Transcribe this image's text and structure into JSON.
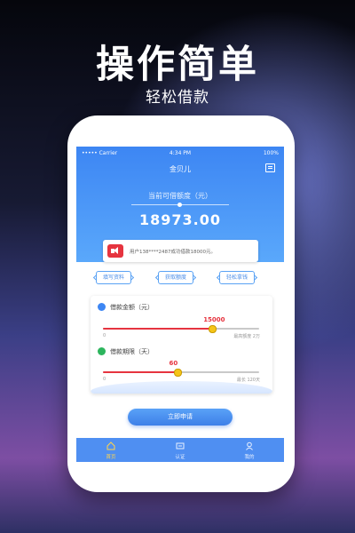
{
  "promo": {
    "headline": "操作简单",
    "subline": "轻松借款"
  },
  "statusbar": {
    "carrier": "••••• Carrier",
    "time": "4:34 PM",
    "battery": "100%"
  },
  "app": {
    "title": "金贝儿"
  },
  "hero": {
    "amount_label": "当前可借额度（元）",
    "amount": "18973.00"
  },
  "notice": {
    "text": "用户138****2487成功借款18000元。"
  },
  "chips": [
    {
      "label": "填写资料"
    },
    {
      "label": "获取额度"
    },
    {
      "label": "轻松拿钱"
    }
  ],
  "loan_amount": {
    "label": "借款金额（元）",
    "value": "15000",
    "fraction": 0.7,
    "min": "0",
    "max": "最高额度 2万",
    "icon_color": "#3d86f3"
  },
  "loan_term": {
    "label": "借款期限（天）",
    "value": "60",
    "fraction": 0.48,
    "min": "0",
    "max": "最长 120天",
    "icon_color": "#2db55d"
  },
  "apply_button": {
    "label": "立即申请"
  },
  "tabs": [
    {
      "label": "首页",
      "icon": "home-icon",
      "active": true
    },
    {
      "label": "认证",
      "icon": "certify-icon",
      "active": false
    },
    {
      "label": "我的",
      "icon": "user-icon",
      "active": false
    }
  ],
  "colors": {
    "primary": "#3d86f3",
    "accent": "#e6343f",
    "thumb": "#f5c518"
  }
}
